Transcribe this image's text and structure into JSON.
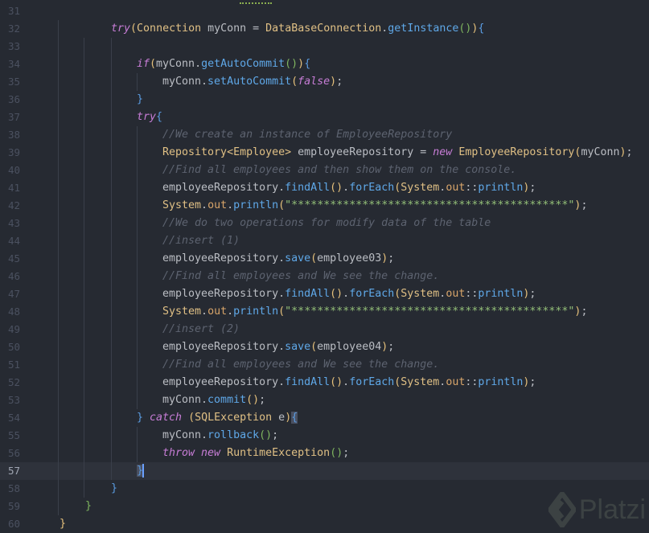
{
  "editor": {
    "current_line": 57,
    "lines": [
      {
        "n": "31",
        "indent": 0,
        "tokens": []
      },
      {
        "n": "32",
        "indent": 8,
        "tokens": [
          [
            "try",
            "k"
          ],
          [
            "(",
            "b1"
          ],
          [
            "Connection",
            "t"
          ],
          [
            " myConn = ",
            ""
          ],
          [
            "DataBaseConnection",
            "t"
          ],
          [
            ".",
            ""
          ],
          [
            "getInstance",
            "m"
          ],
          [
            "()",
            "b2"
          ],
          [
            ")",
            "b1"
          ],
          [
            "{",
            "b3"
          ]
        ]
      },
      {
        "n": "33",
        "indent": 0,
        "tokens": []
      },
      {
        "n": "34",
        "indent": 12,
        "tokens": [
          [
            "if",
            "k"
          ],
          [
            "(",
            "b1"
          ],
          [
            "myConn.",
            ""
          ],
          [
            "getAutoCommit",
            "m"
          ],
          [
            "()",
            "b2"
          ],
          [
            ")",
            "b1"
          ],
          [
            "{",
            "b3"
          ]
        ]
      },
      {
        "n": "35",
        "indent": 16,
        "tokens": [
          [
            "myConn.",
            ""
          ],
          [
            "setAutoCommit",
            "m"
          ],
          [
            "(",
            "b1"
          ],
          [
            "false",
            "k"
          ],
          [
            ")",
            "b1"
          ],
          [
            ";",
            ""
          ]
        ]
      },
      {
        "n": "36",
        "indent": 12,
        "tokens": [
          [
            "}",
            "b3"
          ]
        ]
      },
      {
        "n": "37",
        "indent": 12,
        "tokens": [
          [
            "try",
            "k"
          ],
          [
            "{",
            "b3"
          ]
        ]
      },
      {
        "n": "38",
        "indent": 16,
        "tokens": [
          [
            "//We create an instance of EmployeeRepository",
            "c"
          ]
        ]
      },
      {
        "n": "39",
        "indent": 16,
        "tokens": [
          [
            "Repository",
            "t"
          ],
          [
            "<",
            "t"
          ],
          [
            "Employee",
            "t"
          ],
          [
            ">",
            "t"
          ],
          [
            " employeeRepository = ",
            ""
          ],
          [
            "new",
            "k"
          ],
          [
            " ",
            ""
          ],
          [
            "EmployeeRepository",
            "t"
          ],
          [
            "(",
            "b1"
          ],
          [
            "myConn",
            ""
          ],
          [
            ")",
            "b1"
          ],
          [
            ";",
            ""
          ]
        ]
      },
      {
        "n": "40",
        "indent": 16,
        "tokens": [
          [
            "//Find all employees and then show them on the console.",
            "c"
          ]
        ]
      },
      {
        "n": "41",
        "indent": 16,
        "tokens": [
          [
            "employeeRepository.",
            ""
          ],
          [
            "findAll",
            "m"
          ],
          [
            "()",
            "b1"
          ],
          [
            ".",
            ""
          ],
          [
            "forEach",
            "m"
          ],
          [
            "(",
            "b1"
          ],
          [
            "System",
            "t"
          ],
          [
            ".",
            ""
          ],
          [
            "out",
            "f"
          ],
          [
            "::",
            ""
          ],
          [
            "println",
            "m"
          ],
          [
            ")",
            "b1"
          ],
          [
            ";",
            ""
          ]
        ]
      },
      {
        "n": "42",
        "indent": 16,
        "tokens": [
          [
            "System",
            "t"
          ],
          [
            ".",
            ""
          ],
          [
            "out",
            "f"
          ],
          [
            ".",
            ""
          ],
          [
            "println",
            "m"
          ],
          [
            "(",
            "b1"
          ],
          [
            "\"*******************************************\"",
            "s"
          ],
          [
            ")",
            "b1"
          ],
          [
            ";",
            ""
          ]
        ]
      },
      {
        "n": "43",
        "indent": 16,
        "tokens": [
          [
            "//We do two operations for modify data of the table",
            "c"
          ]
        ]
      },
      {
        "n": "44",
        "indent": 16,
        "tokens": [
          [
            "//insert (1)",
            "c"
          ]
        ]
      },
      {
        "n": "45",
        "indent": 16,
        "tokens": [
          [
            "employeeRepository.",
            ""
          ],
          [
            "save",
            "m"
          ],
          [
            "(",
            "b1"
          ],
          [
            "employee03",
            ""
          ],
          [
            ")",
            "b1"
          ],
          [
            ";",
            ""
          ]
        ]
      },
      {
        "n": "46",
        "indent": 16,
        "tokens": [
          [
            "//Find all employees and We see the change.",
            "c"
          ]
        ]
      },
      {
        "n": "47",
        "indent": 16,
        "tokens": [
          [
            "employeeRepository.",
            ""
          ],
          [
            "findAll",
            "m"
          ],
          [
            "()",
            "b1"
          ],
          [
            ".",
            ""
          ],
          [
            "forEach",
            "m"
          ],
          [
            "(",
            "b1"
          ],
          [
            "System",
            "t"
          ],
          [
            ".",
            ""
          ],
          [
            "out",
            "f"
          ],
          [
            "::",
            ""
          ],
          [
            "println",
            "m"
          ],
          [
            ")",
            "b1"
          ],
          [
            ";",
            ""
          ]
        ]
      },
      {
        "n": "48",
        "indent": 16,
        "tokens": [
          [
            "System",
            "t"
          ],
          [
            ".",
            ""
          ],
          [
            "out",
            "f"
          ],
          [
            ".",
            ""
          ],
          [
            "println",
            "m"
          ],
          [
            "(",
            "b1"
          ],
          [
            "\"*******************************************\"",
            "s"
          ],
          [
            ")",
            "b1"
          ],
          [
            ";",
            ""
          ]
        ]
      },
      {
        "n": "49",
        "indent": 16,
        "tokens": [
          [
            "//insert (2)",
            "c"
          ]
        ]
      },
      {
        "n": "50",
        "indent": 16,
        "tokens": [
          [
            "employeeRepository.",
            ""
          ],
          [
            "save",
            "m"
          ],
          [
            "(",
            "b1"
          ],
          [
            "employee04",
            ""
          ],
          [
            ")",
            "b1"
          ],
          [
            ";",
            ""
          ]
        ]
      },
      {
        "n": "51",
        "indent": 16,
        "tokens": [
          [
            "//Find all employees and We see the change.",
            "c"
          ]
        ]
      },
      {
        "n": "52",
        "indent": 16,
        "tokens": [
          [
            "employeeRepository.",
            ""
          ],
          [
            "findAll",
            "m"
          ],
          [
            "()",
            "b1"
          ],
          [
            ".",
            ""
          ],
          [
            "forEach",
            "m"
          ],
          [
            "(",
            "b1"
          ],
          [
            "System",
            "t"
          ],
          [
            ".",
            ""
          ],
          [
            "out",
            "f"
          ],
          [
            "::",
            ""
          ],
          [
            "println",
            "m"
          ],
          [
            ")",
            "b1"
          ],
          [
            ";",
            ""
          ]
        ]
      },
      {
        "n": "53",
        "indent": 16,
        "tokens": [
          [
            "myConn.",
            ""
          ],
          [
            "commit",
            "m"
          ],
          [
            "()",
            "b1"
          ],
          [
            ";",
            ""
          ]
        ]
      },
      {
        "n": "54",
        "indent": 12,
        "tokens": [
          [
            "}",
            "b3"
          ],
          [
            " ",
            ""
          ],
          [
            "catch",
            "k"
          ],
          [
            " ",
            ""
          ],
          [
            "(",
            "b1"
          ],
          [
            "SQLException",
            "t"
          ],
          [
            " e",
            ""
          ],
          [
            ")",
            "b1"
          ],
          [
            "{",
            "b3 hl"
          ]
        ]
      },
      {
        "n": "55",
        "indent": 16,
        "tokens": [
          [
            "myConn.",
            ""
          ],
          [
            "rollback",
            "m"
          ],
          [
            "()",
            "b2"
          ],
          [
            ";",
            ""
          ]
        ]
      },
      {
        "n": "56",
        "indent": 16,
        "tokens": [
          [
            "throw",
            "k"
          ],
          [
            " ",
            ""
          ],
          [
            "new",
            "k"
          ],
          [
            " ",
            ""
          ],
          [
            "RuntimeException",
            "t"
          ],
          [
            "()",
            "b2"
          ],
          [
            ";",
            ""
          ]
        ]
      },
      {
        "n": "57",
        "indent": 12,
        "tokens": [
          [
            "}",
            "b3 hl"
          ]
        ]
      },
      {
        "n": "58",
        "indent": 8,
        "tokens": [
          [
            "}",
            "b3"
          ]
        ]
      },
      {
        "n": "59",
        "indent": 4,
        "tokens": [
          [
            "}",
            "b2"
          ]
        ]
      },
      {
        "n": "60",
        "indent": 0,
        "tokens": [
          [
            "}",
            "b1"
          ]
        ]
      }
    ]
  },
  "watermark": {
    "text": "Platzi"
  }
}
